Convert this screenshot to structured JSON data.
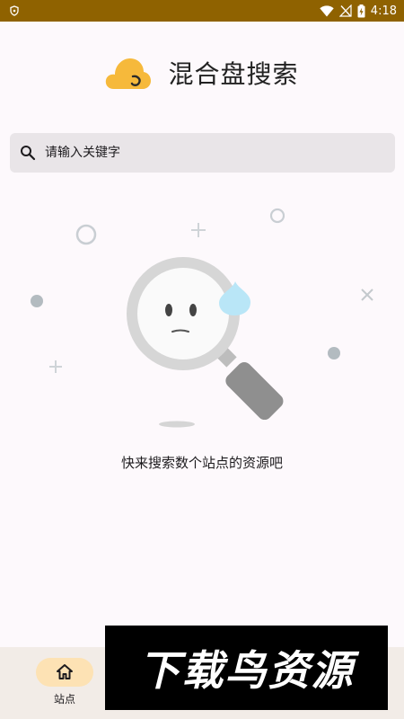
{
  "status_bar": {
    "time": "4:18",
    "icons": [
      "shield-icon",
      "wifi-icon",
      "no-signal-icon",
      "battery-charging-icon"
    ],
    "background": "#8f6200"
  },
  "header": {
    "title": "混合盘搜索",
    "logo": "cloud-logo-icon",
    "logo_color": "#f6b93b"
  },
  "search": {
    "placeholder": "请输入关键字",
    "value": ""
  },
  "empty_state": {
    "illustration": "magnifier-sweat-face",
    "message": "快来搜索数个站点的资源吧"
  },
  "bottom_nav": {
    "items": [
      {
        "label": "站点",
        "icon": "home-icon",
        "selected": true
      }
    ],
    "indicator_color": "#fde2b4"
  },
  "watermark": {
    "text": "下载鸟资源"
  }
}
